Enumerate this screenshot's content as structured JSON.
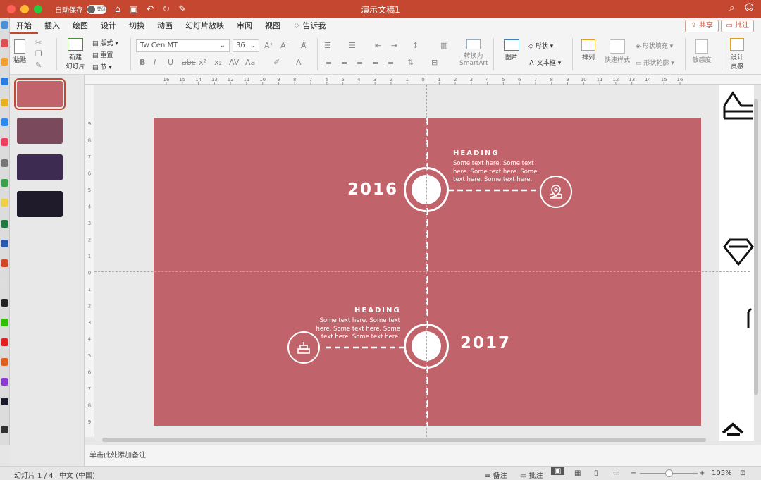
{
  "window": {
    "title": "演示文稿1",
    "autosave_label": "自动保存",
    "autosave_state": "关闭"
  },
  "tabs": [
    "开始",
    "插入",
    "绘图",
    "设计",
    "切换",
    "动画",
    "幻灯片放映",
    "审阅",
    "视图",
    "告诉我"
  ],
  "share_label": "共享",
  "comment_label": "批注",
  "ribbon": {
    "paste": "粘贴",
    "new_slide_1": "新建",
    "new_slide_2": "幻灯片",
    "layout": "版式",
    "reset": "重置",
    "section": "节",
    "font_name": "Tw Cen MT",
    "font_size": "36",
    "convert_smartart_1": "转换为",
    "convert_smartart_2": "SmartArt",
    "picture": "图片",
    "shape": "形状",
    "textbox": "文本框",
    "arrange": "排列",
    "quick_style": "快速样式",
    "shape_fill": "形状填充",
    "shape_outline": "形状轮廓",
    "sensitivity": "敏感度",
    "designer_1": "设计",
    "designer_2": "灵感"
  },
  "thumbnails": [
    {
      "color": "#c0636a",
      "selected": true
    },
    {
      "color": "#7a4a5c",
      "selected": false
    },
    {
      "color": "#3d2b52",
      "selected": false
    },
    {
      "color": "#1f1b2b",
      "selected": false
    }
  ],
  "hruler_labels": [
    "16",
    "15",
    "14",
    "13",
    "12",
    "11",
    "10",
    "9",
    "8",
    "7",
    "6",
    "5",
    "4",
    "3",
    "2",
    "1",
    "0",
    "1",
    "2",
    "3",
    "4",
    "5",
    "6",
    "7",
    "8",
    "9",
    "10",
    "11",
    "12",
    "13",
    "14",
    "15",
    "16"
  ],
  "vruler_labels": [
    "9",
    "8",
    "7",
    "6",
    "5",
    "4",
    "3",
    "2",
    "1",
    "0",
    "1",
    "2",
    "3",
    "4",
    "5",
    "6",
    "7",
    "8",
    "9"
  ],
  "slide": {
    "color": "#c0636a",
    "item1": {
      "year": "2016",
      "heading": "HEADING",
      "body_lines": [
        "Some text here. Some text",
        "here. Some text here. Some",
        "text here. Some text here."
      ]
    },
    "item2": {
      "year": "2017",
      "heading": "HEADING",
      "body_lines": [
        "Some text here. Some text",
        "here. Some text here. Some",
        "text here. Some text here."
      ]
    }
  },
  "notes_placeholder": "单击此处添加备注",
  "status": {
    "slide_info": "幻灯片 1 / 4",
    "language": "中文 (中国)",
    "notes": "备注",
    "comments": "批注",
    "zoom": "105%"
  }
}
